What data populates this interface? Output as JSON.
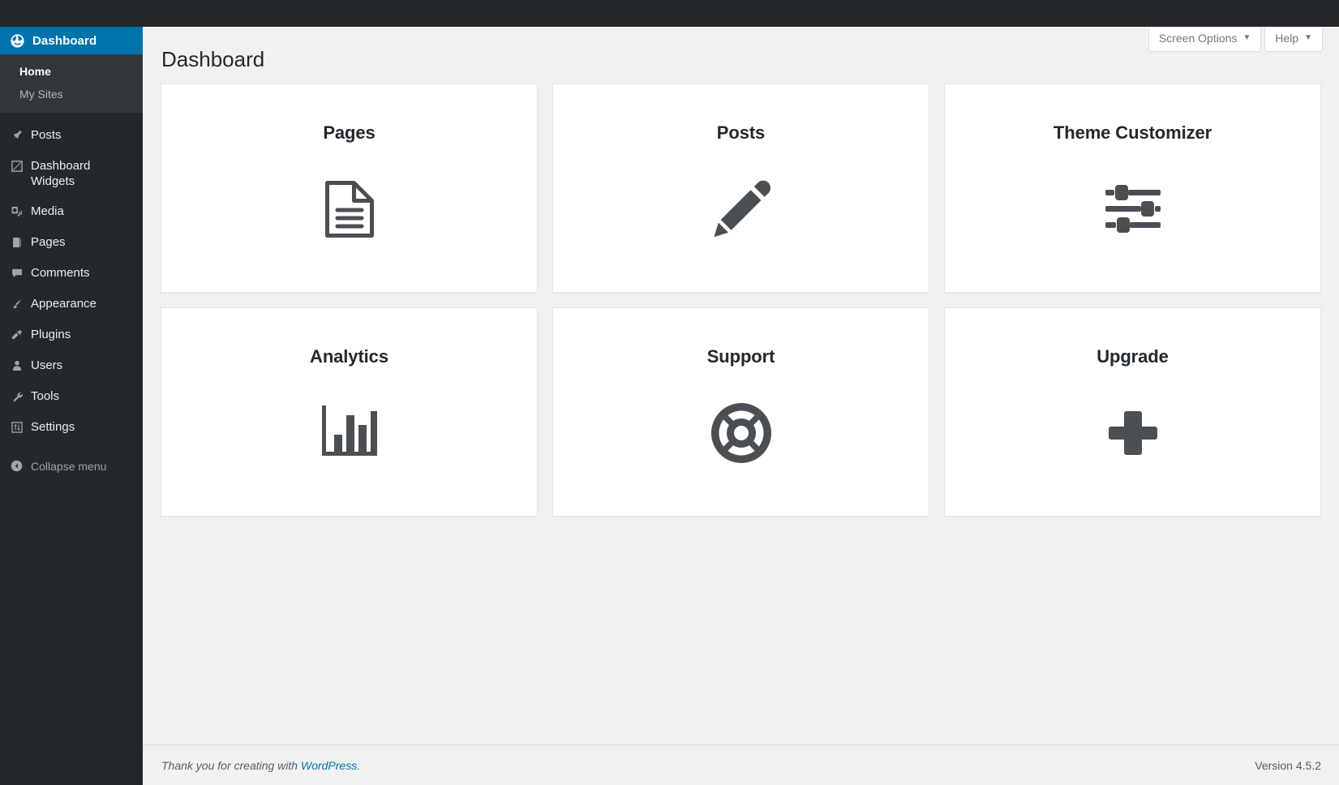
{
  "colors": {
    "admin_bar": "#23282d",
    "sidebar": "#23282d",
    "sidebar_active": "#0073aa",
    "submenu_bg": "#32373c",
    "content_bg": "#f1f1f1",
    "card_bg": "#ffffff",
    "link": "#0073aa",
    "icon": "#4b4f53"
  },
  "sidebar": {
    "top": {
      "label": "Dashboard",
      "icon": "dashboard-icon",
      "active": true
    },
    "submenu": [
      {
        "label": "Home",
        "current": true
      },
      {
        "label": "My Sites",
        "current": false
      }
    ],
    "items": [
      {
        "label": "Posts",
        "icon": "pin-icon"
      },
      {
        "label": "Dashboard Widgets",
        "icon": "widget-icon"
      },
      {
        "label": "Media",
        "icon": "camera-icon"
      },
      {
        "label": "Pages",
        "icon": "page-icon"
      },
      {
        "label": "Comments",
        "icon": "comment-icon"
      },
      {
        "label": "Appearance",
        "icon": "brush-icon"
      },
      {
        "label": "Plugins",
        "icon": "plug-icon"
      },
      {
        "label": "Users",
        "icon": "user-icon"
      },
      {
        "label": "Tools",
        "icon": "wrench-icon"
      },
      {
        "label": "Settings",
        "icon": "settings-icon"
      }
    ],
    "collapse": {
      "label": "Collapse menu",
      "icon": "collapse-arrow-icon"
    }
  },
  "screen_meta": {
    "screen_options": {
      "label": "Screen Options",
      "caret": "▼"
    },
    "help": {
      "label": "Help",
      "caret": "▼"
    }
  },
  "main": {
    "page_title": "Dashboard",
    "cards": [
      {
        "title": "Pages",
        "icon": "document-icon"
      },
      {
        "title": "Posts",
        "icon": "pencil-icon"
      },
      {
        "title": "Theme Customizer",
        "icon": "sliders-icon"
      },
      {
        "title": "Analytics",
        "icon": "bar-chart-icon"
      },
      {
        "title": "Support",
        "icon": "lifebuoy-icon"
      },
      {
        "title": "Upgrade",
        "icon": "plus-icon"
      }
    ]
  },
  "footer": {
    "thanks_prefix": "Thank you for creating with ",
    "wordpress_link": "WordPress",
    "thanks_suffix": ".",
    "version": "Version 4.5.2"
  }
}
